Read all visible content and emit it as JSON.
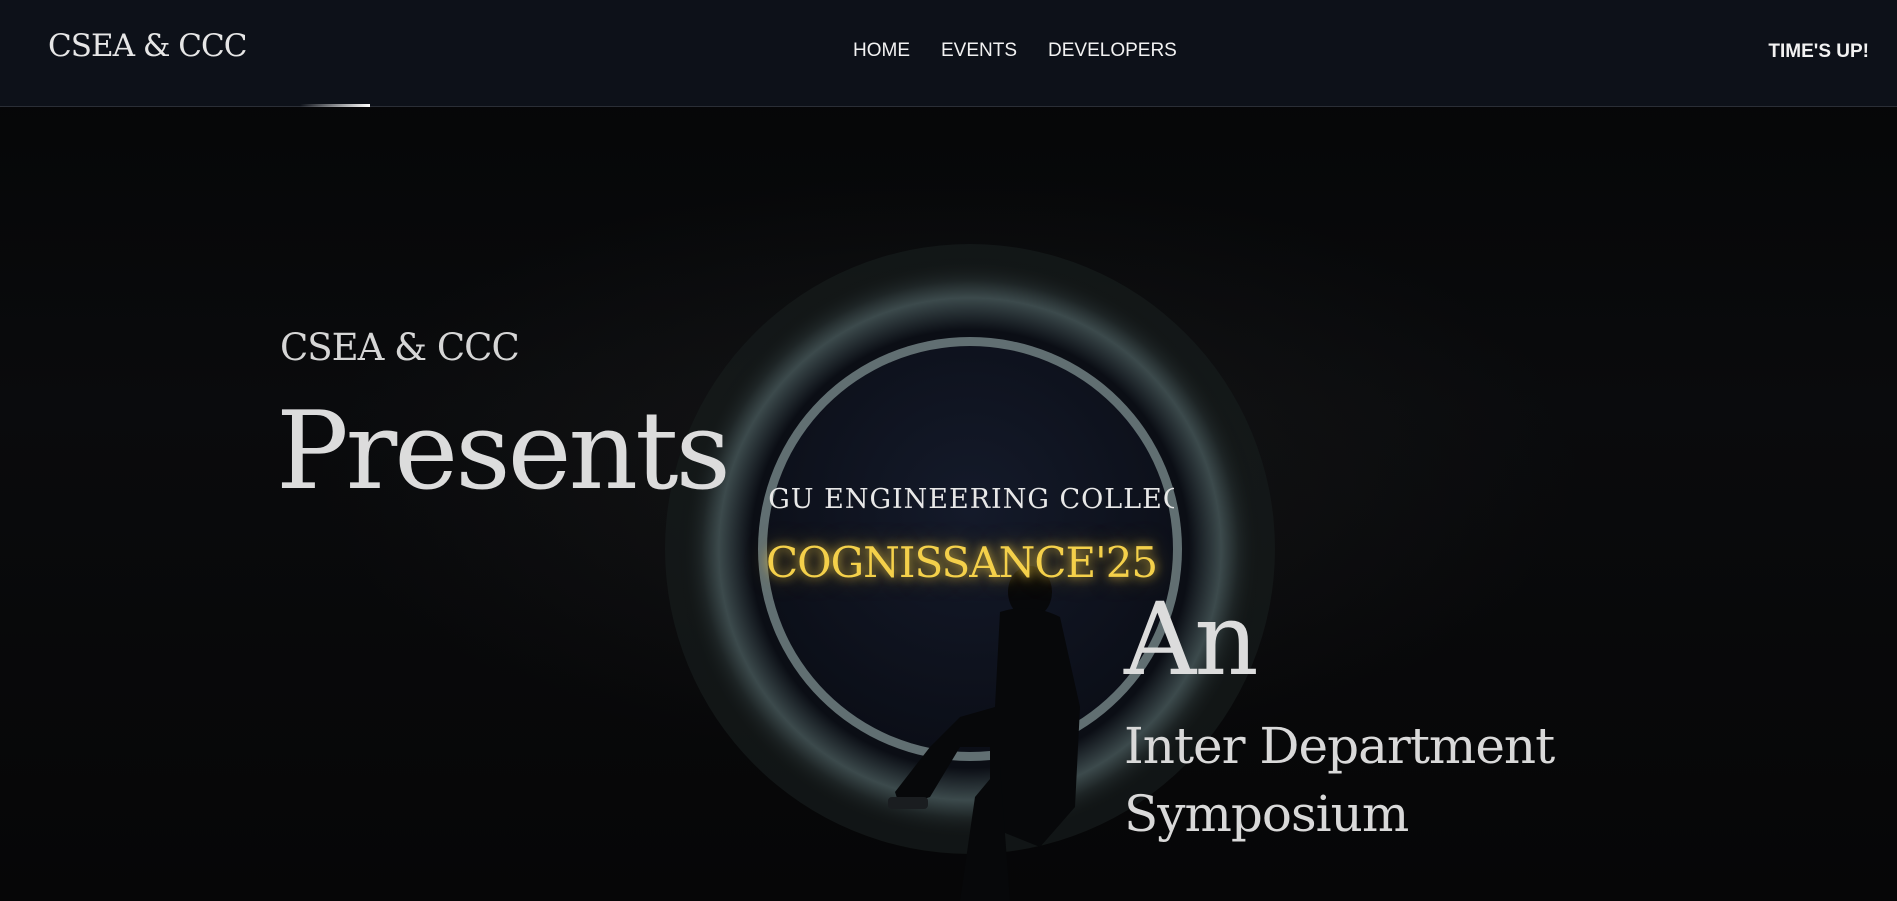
{
  "navbar": {
    "brand": "CSEA & CCC",
    "links": [
      {
        "label": "HOME"
      },
      {
        "label": "EVENTS"
      },
      {
        "label": "DEVELOPERS"
      }
    ],
    "countdown": "TIME'S UP!"
  },
  "hero": {
    "org": "CSEA & CCC",
    "presents": "Presents",
    "college_marquee": "KONGU ENGINEERING COLLEGE",
    "event_name": "COGNISSANCE'25",
    "an": "An",
    "subtitle_line1": "Inter Department",
    "subtitle_line2": "Symposium"
  },
  "colors": {
    "navbar_bg": "#0d1119",
    "page_bg": "#050607",
    "event_name_gold": "#f4d04a",
    "text_light": "#dcdcdc"
  },
  "icons": {
    "hero_image": "person-sitting-in-circular-tunnel"
  }
}
